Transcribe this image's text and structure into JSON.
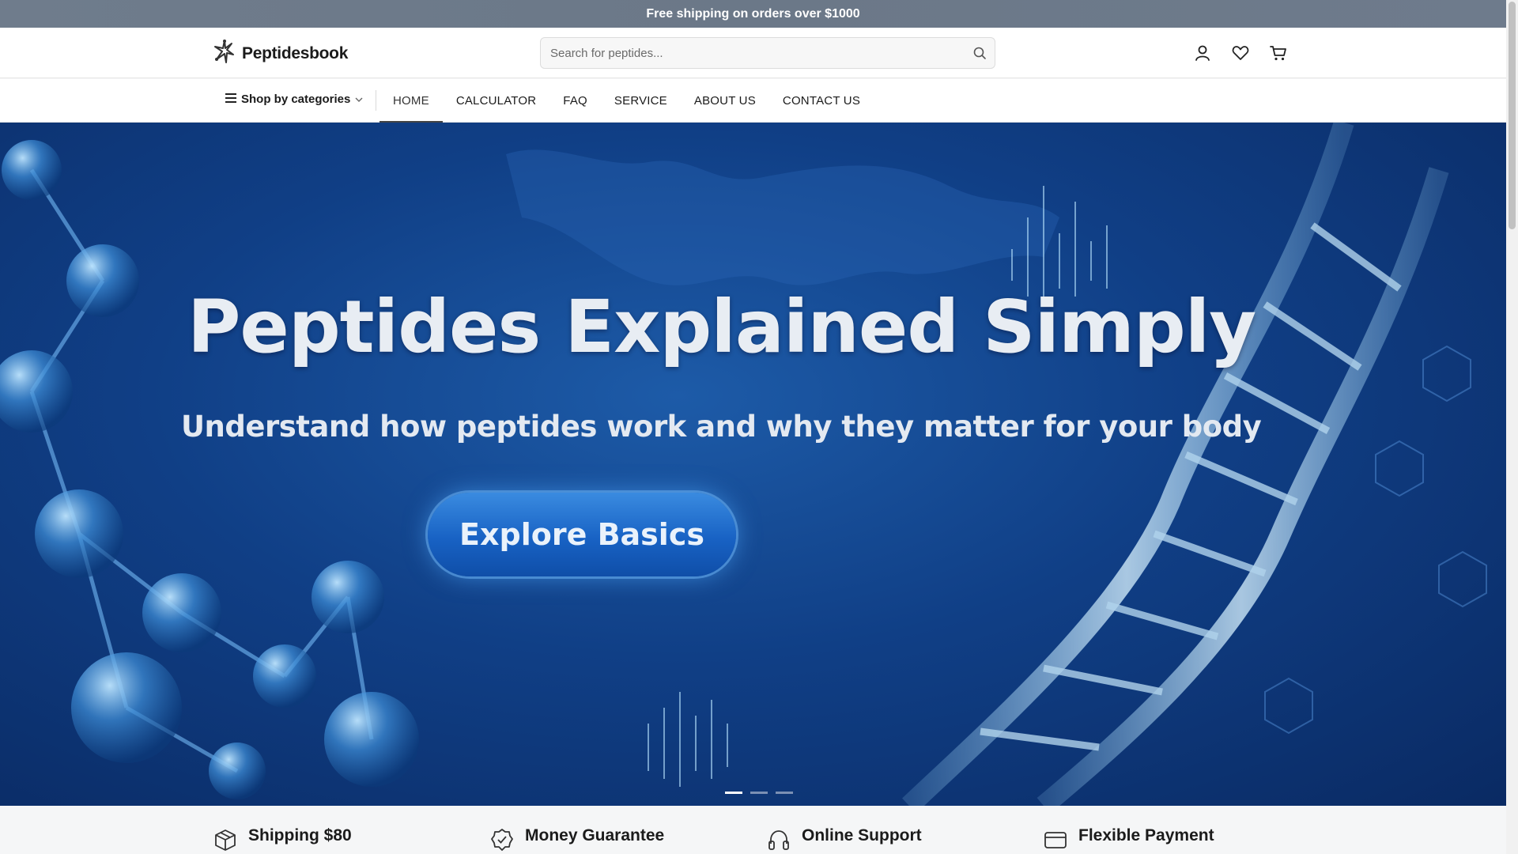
{
  "announcement": {
    "text": "Free shipping on orders over $1000"
  },
  "header": {
    "brand": "Peptidesbook",
    "search_placeholder": "Search for peptides..."
  },
  "nav": {
    "categories_label": "Shop by categories",
    "links": [
      "HOME",
      "CALCULATOR",
      "FAQ",
      "SERVICE",
      "ABOUT US",
      "CONTACT US"
    ],
    "active": "HOME"
  },
  "hero": {
    "title": "Peptides Explained Simply",
    "subtitle": "Understand how peptides work and why they matter for your body",
    "button_label": "Explore Basics",
    "slide_count": 3,
    "active_slide": 1
  },
  "features": [
    {
      "title": "Shipping $80",
      "icon": "box-icon"
    },
    {
      "title": "Money Guarantee",
      "icon": "badge-check-icon"
    },
    {
      "title": "Online Support",
      "icon": "headphones-icon"
    },
    {
      "title": "Flexible Payment",
      "icon": "credit-card-icon"
    }
  ],
  "colors": {
    "announcement_bg": "#6f7c8c",
    "hero_blue": "#103f86",
    "accent": "#1862c4"
  }
}
